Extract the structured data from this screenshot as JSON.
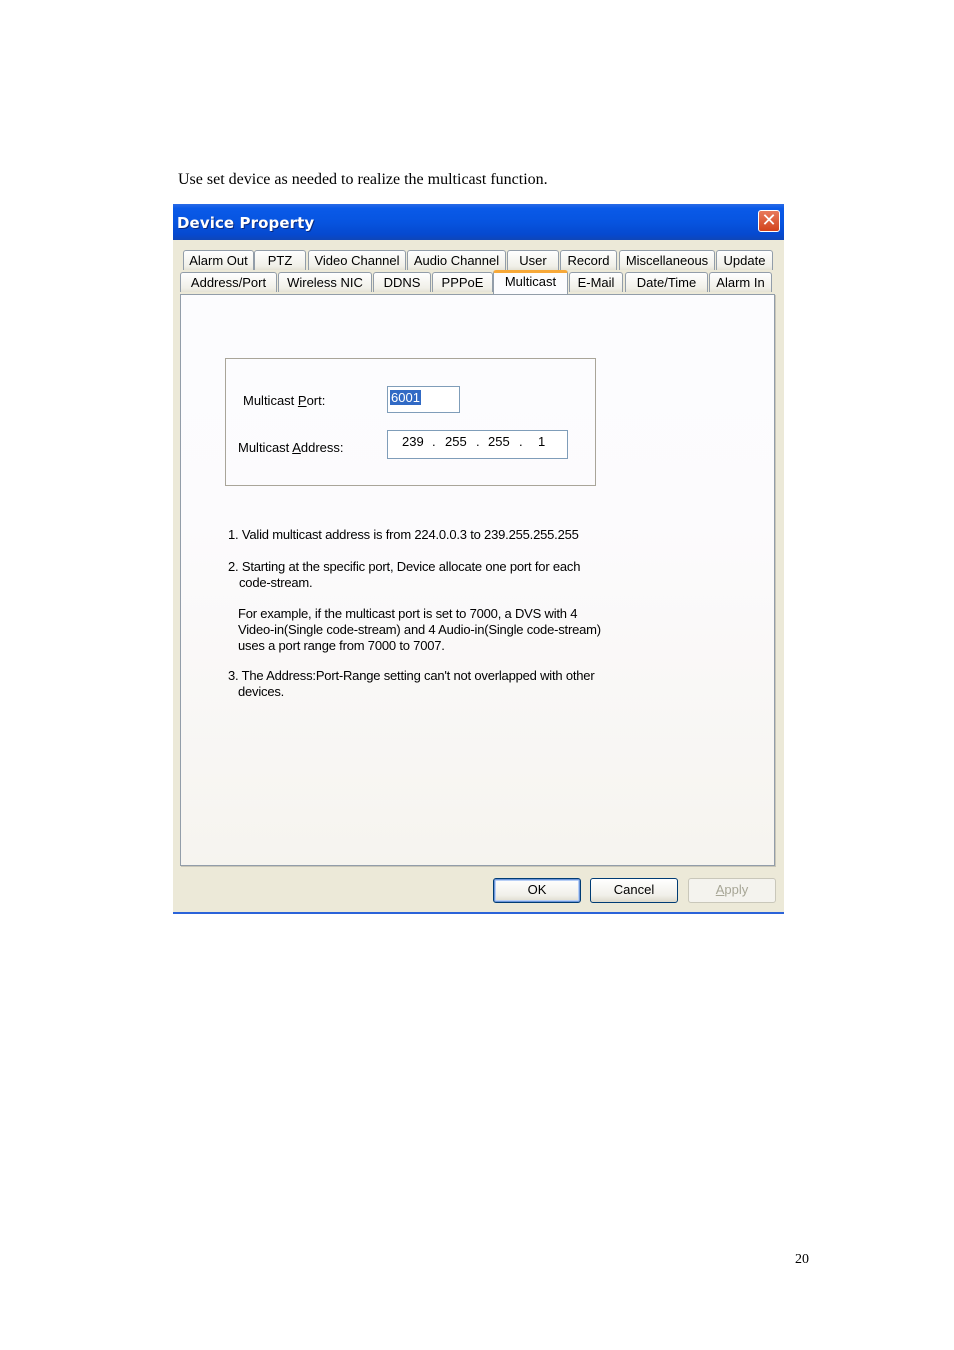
{
  "document": {
    "intro_text": "Use set device as needed to realize the multicast function.",
    "page_number": "20"
  },
  "dialog": {
    "title": "Device Property",
    "close_icon": "close-icon",
    "tabs_row1": [
      {
        "label": "Alarm Out"
      },
      {
        "label": "PTZ"
      },
      {
        "label": "Video Channel"
      },
      {
        "label": "Audio Channel"
      },
      {
        "label": "User"
      },
      {
        "label": "Record"
      },
      {
        "label": "Miscellaneous"
      },
      {
        "label": "Update"
      }
    ],
    "tabs_row2": [
      {
        "label": "Address/Port"
      },
      {
        "label": "Wireless NIC"
      },
      {
        "label": "DDNS"
      },
      {
        "label": "PPPoE"
      },
      {
        "label": "Multicast",
        "active": true
      },
      {
        "label": "E-Mail"
      },
      {
        "label": "Date/Time"
      },
      {
        "label": "Alarm In"
      }
    ],
    "form": {
      "port_label_pre": "Multicast ",
      "port_label_accel": "P",
      "port_label_post": "ort:",
      "port_value": "6001",
      "address_label_pre": "Multicast ",
      "address_label_accel": "A",
      "address_label_post": "ddress:",
      "address_octets": [
        "239",
        "255",
        "255",
        "1"
      ],
      "address_separator": "."
    },
    "notes": {
      "note1": "1. Valid multicast address is from 224.0.0.3 to 239.255.255.255",
      "note2_line1": "2. Starting at the specific port, Device allocate one port for each",
      "note2_line2": "code-stream.",
      "example_line1": "For example, if the multicast port is set to 7000, a DVS with 4",
      "example_line2": "Video-in(Single code-stream) and 4 Audio-in(Single code-stream)",
      "example_line3": "uses a port range from 7000 to 7007.",
      "note3_line1": "3. The Address:Port-Range setting can't not overlapped with other",
      "note3_line2": "devices."
    },
    "buttons": {
      "ok": "OK",
      "cancel": "Cancel",
      "apply_accel": "A",
      "apply_rest": "pply"
    }
  }
}
